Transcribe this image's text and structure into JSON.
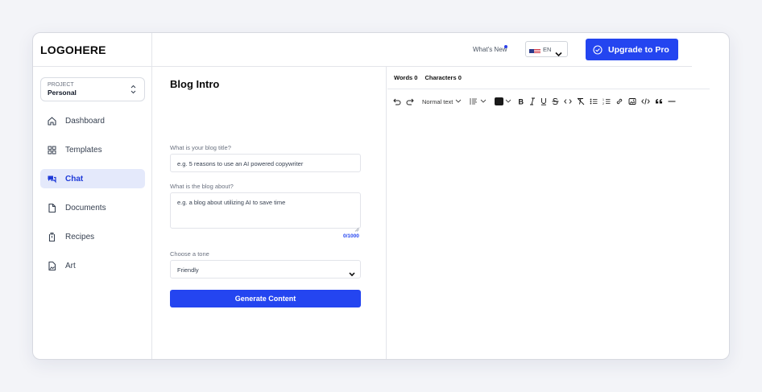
{
  "sidebar": {
    "logo": "LOGOHERE",
    "project": {
      "label": "PROJECT",
      "value": "Personal"
    },
    "items": [
      {
        "label": "Dashboard",
        "icon": "home-icon",
        "active": false
      },
      {
        "label": "Templates",
        "icon": "grid-icon",
        "active": false
      },
      {
        "label": "Chat",
        "icon": "chat-icon",
        "active": true
      },
      {
        "label": "Documents",
        "icon": "document-icon",
        "active": false
      },
      {
        "label": "Recipes",
        "icon": "recipe-icon",
        "active": false
      },
      {
        "label": "Art",
        "icon": "image-icon",
        "active": false
      }
    ]
  },
  "header": {
    "whats_new": "What's New",
    "language": "EN",
    "upgrade_label": "Upgrade to Pro"
  },
  "form": {
    "title": "Blog Intro",
    "title_field": {
      "label": "What is your blog title?",
      "placeholder": "e.g. 5 reasons to use an AI powered copywriter"
    },
    "about_field": {
      "label": "What is the blog about?",
      "placeholder": "e.g. a blog about utilizing AI to save time"
    },
    "counter": "0/1000",
    "tone_field": {
      "label": "Choose a tone",
      "value": "Friendly"
    },
    "generate_label": "Generate Content"
  },
  "editor": {
    "words": "Words 0",
    "characters": "Characters 0",
    "text_style": "Normal text"
  },
  "colors": {
    "accent": "#2445f0",
    "active_bg": "#e4e9fb"
  }
}
